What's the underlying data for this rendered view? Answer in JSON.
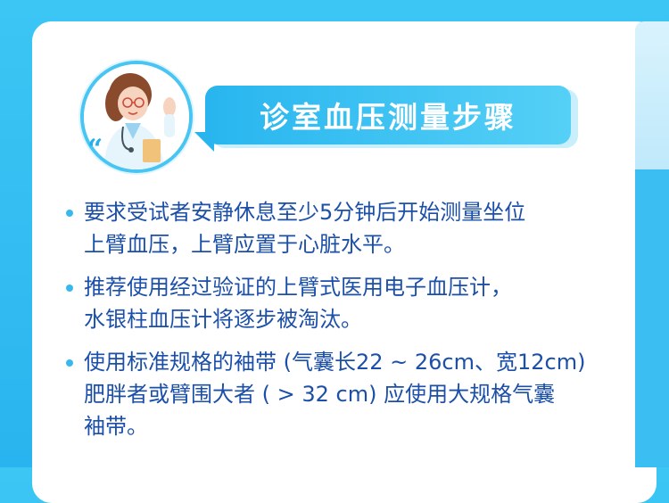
{
  "title": "诊室血压测量步骤",
  "avatar": {
    "icon": "doctor-avatar-icon",
    "quote_glyph": "“"
  },
  "colors": {
    "background": "#2ab4ef",
    "text": "#1b4fa8",
    "accent": "#39b8ee"
  },
  "bullets": [
    {
      "lines": [
        "要求受试者安静休息至少5分钟后开始测量坐位",
        "上臂血压，上臂应置于心脏水平。"
      ]
    },
    {
      "lines": [
        "推荐使用经过验证的上臂式医用电子血压计，",
        "水银柱血压计将逐步被淘汰。"
      ]
    },
    {
      "lines": [
        "使用标准规格的袖带 (气囊长22 ~ 26cm、宽12cm)",
        "肥胖者或臂围大者 ( > 32 cm) 应使用大规格气囊",
        "袖带。"
      ]
    }
  ]
}
